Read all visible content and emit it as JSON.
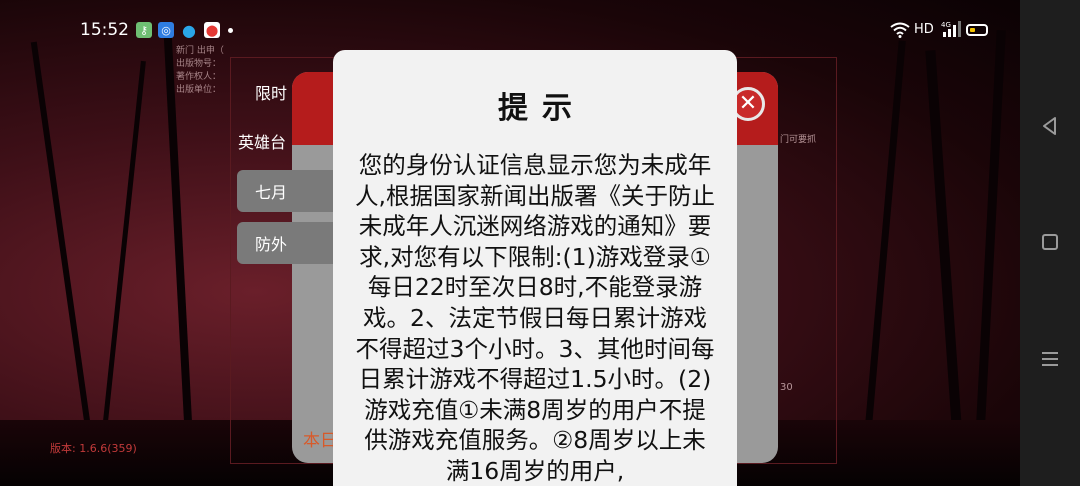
{
  "status_bar": {
    "time": "15:52",
    "network_label": "HD",
    "signal_label": "4G",
    "app_icons": [
      {
        "name": "key-app-icon",
        "color": "#6fbf73"
      },
      {
        "name": "blue-app-icon",
        "color": "#2f7de1"
      },
      {
        "name": "qq-icon",
        "color": "#2aa6e8"
      },
      {
        "name": "map-pin-app-icon",
        "color": "#e53935"
      }
    ],
    "battery_level": 0.35,
    "battery_color": "#f5c400"
  },
  "background_game": {
    "copyright_lines": [
      "新门 出申（",
      "出版物号：",
      "著作权人：",
      "出版单位："
    ],
    "version": "版本: 1.6.6(359)",
    "right_text": "门可要抓",
    "right_number": "30",
    "bottom_notice_left": "",
    "bottom_notice_right": ""
  },
  "under_dialog": {
    "title": "限时",
    "tab_label": "英雄台",
    "pill_1": "七月",
    "pill_2": "防外",
    "link_text": "本日",
    "header_color": "#b51c1c"
  },
  "dialog": {
    "title": "提示",
    "body": "您的身份认证信息显示您为未成年人,根据国家新闻出版署《关于防止未成年人沉迷网络游戏的通知》要求,对您有以下限制:(1)游戏登录①每日22时至次日8时,不能登录游戏。2、法定节假日每日累计游戏不得超过3个小时。3、其他时间每日累计游戏不得超过1.5小时。(2)游戏充值①未满8周岁的用户不提供游戏充值服务。②8周岁以上未满16周岁的用户,"
  },
  "nav_bar": {
    "back_icon": "back-triangle-icon",
    "home_icon": "home-square-icon",
    "menu_icon": "menu-lines-icon"
  }
}
